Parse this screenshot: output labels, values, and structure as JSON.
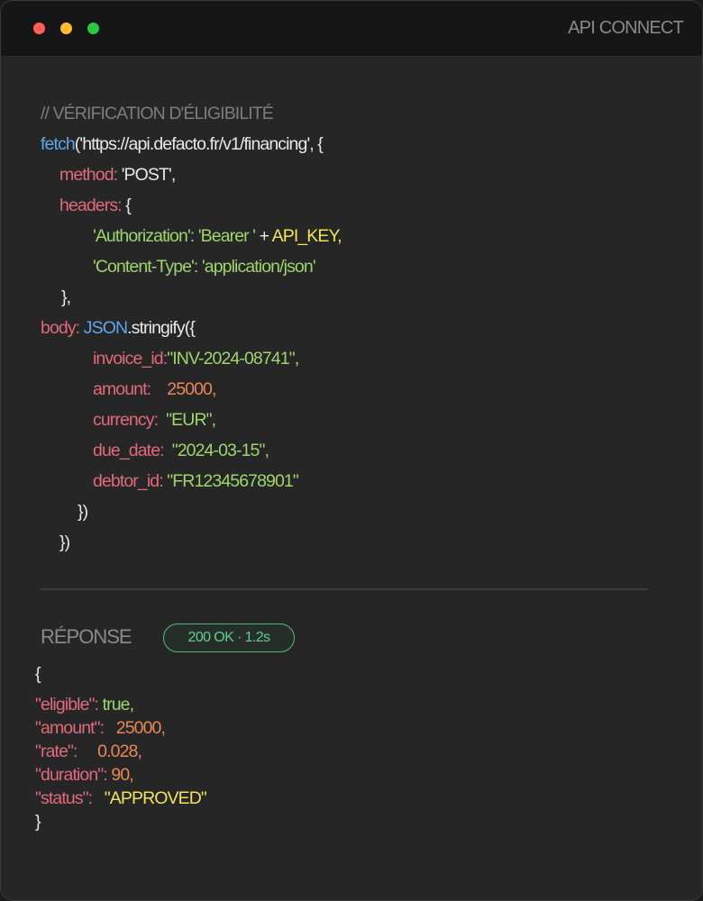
{
  "window": {
    "title": "API CONNECT",
    "controls": [
      "close",
      "minimize",
      "maximize"
    ]
  },
  "request": {
    "comment": "// VÉRIFICATION D'ÉLIGIBILITÉ",
    "fetch_fn": "fetch",
    "fetch_args": "('https://api.defacto.fr/v1/financing', {",
    "method_key": "method:",
    "method_value": "'POST',",
    "headers_key": "headers:",
    "headers_open": "{",
    "auth_key": "'Authorization':",
    "auth_value": "'Bearer '",
    "auth_plus": "+",
    "auth_var": "API_KEY,",
    "ct_key": "'Content-Type':",
    "ct_value": "'application/json'",
    "headers_close": "},",
    "body_key": "body:",
    "json_obj": "JSON",
    "stringify": ".stringify({",
    "fields": [
      {
        "key": "invoice_id:",
        "value": "\"INV-2024-08741\",",
        "kind": "st"
      },
      {
        "key": "amount:",
        "value": "25000,",
        "kind": "nu"
      },
      {
        "key": "currency:",
        "value": "\"EUR\",",
        "kind": "st"
      },
      {
        "key": "due_date:",
        "value": "\"2024-03-15\",",
        "kind": "st"
      },
      {
        "key": "debtor_id:",
        "value": "\"FR12345678901\"",
        "kind": "st"
      }
    ],
    "close_inner": "})",
    "close_outer": "})"
  },
  "response": {
    "label": "RÉPONSE",
    "status_badge": "200 OK · 1.2s",
    "open": "{",
    "fields": [
      {
        "key": "\"eligible\":",
        "value": "true,",
        "kind": "st"
      },
      {
        "key": "\"amount\":",
        "value": "25000,",
        "kind": "nu"
      },
      {
        "key": "\"rate\":",
        "value": "0.028,",
        "kind": "nu"
      },
      {
        "key": "\"duration\":",
        "value": "90,",
        "kind": "nu"
      },
      {
        "key": "\"status\":",
        "value": "\"APPROVED\"",
        "kind": "yl"
      }
    ],
    "close": "}"
  },
  "colors": {
    "comment": "#7d7d7d",
    "function": "#5ea7ea",
    "key": "#e06a7b",
    "string": "#9ed56c",
    "number": "#e8875a",
    "highlight": "#f2e25a",
    "badge": "#4cbe7c"
  }
}
